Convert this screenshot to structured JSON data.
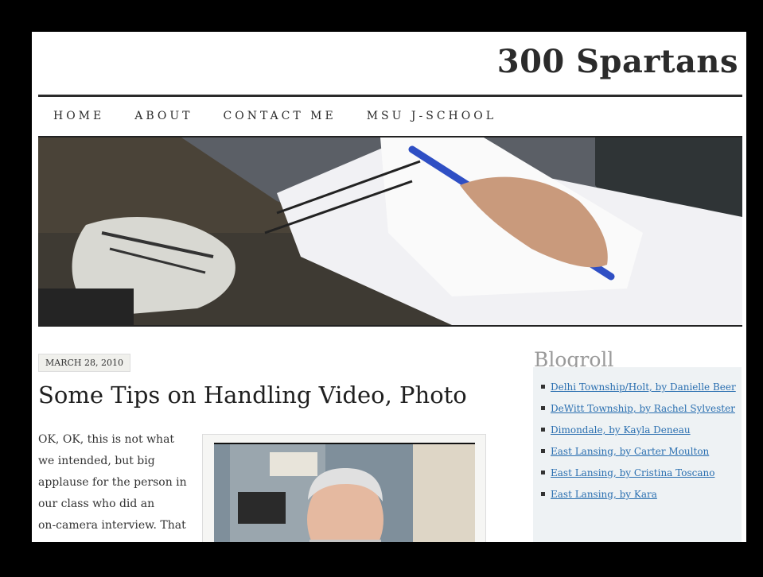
{
  "site": {
    "title": "300 Spartans"
  },
  "nav": {
    "items": [
      "HOME",
      "ABOUT",
      "CONTACT ME",
      "MSU J-SCHOOL"
    ]
  },
  "post": {
    "date": "MARCH 28, 2010",
    "title": "Some Tips on Handling Video, Photo",
    "lines": [
      "OK, OK, this is not what",
      "we intended, but big",
      "applause for the person in",
      "our class who did an",
      "on-camera interview. That"
    ]
  },
  "sidebar": {
    "title": "Blogroll",
    "links": [
      "Delhi Township/Holt, by Danielle Beer",
      "DeWitt Township, by Rachel Sylvester",
      "Dimondale, by Kayla Deneau",
      "East Lansing, by Carter Moulton",
      "East Lansing, by Cristina Toscano",
      "East Lansing, by Kara"
    ]
  },
  "colors": {
    "link": "#2a6fb0",
    "sidebar_bg": "#eef2f4",
    "title": "#2b2b2b"
  }
}
